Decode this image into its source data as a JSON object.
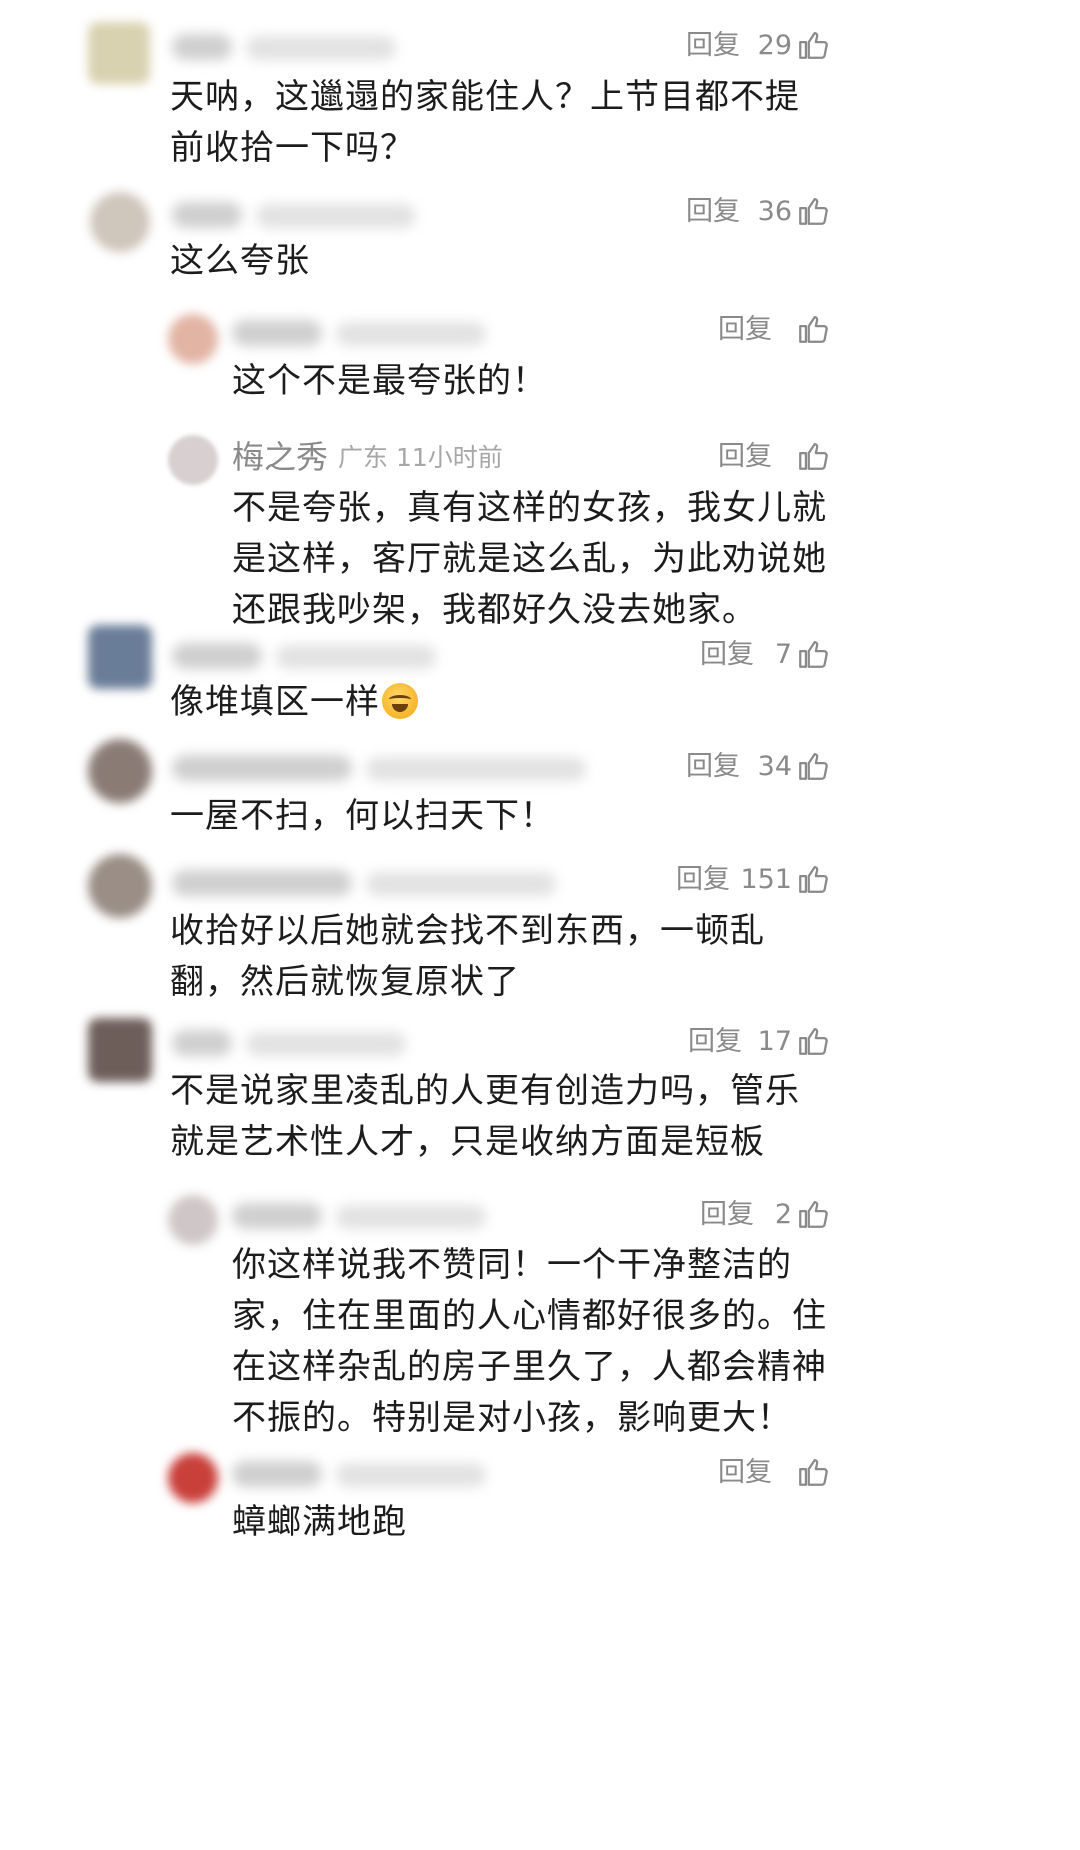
{
  "comments": [
    {
      "reply_label": "回复",
      "likes": "29",
      "text": "天呐，这邋遢的家能住人？上节目都不提前收拾一下吗？"
    },
    {
      "reply_label": "回复",
      "likes": "36",
      "text": "这么夸张"
    },
    {
      "reply_label": "回复",
      "likes": "",
      "text": "这个不是最夸张的！"
    },
    {
      "reply_label": "回复",
      "likes": "",
      "user_name": "梅之秀",
      "meta": "广东 11小时前",
      "text": "不是夸张，真有这样的女孩，我女儿就是这样，客厅就是这么乱，为此劝说她还跟我吵架，我都好久没去她家。"
    },
    {
      "reply_label": "回复",
      "likes": "7",
      "text": "像堆填区一样"
    },
    {
      "reply_label": "回复",
      "likes": "34",
      "text": "一屋不扫，何以扫天下！"
    },
    {
      "reply_label": "回复",
      "likes": "151",
      "text": "收拾好以后她就会找不到东西，一顿乱翻，然后就恢复原状了"
    },
    {
      "reply_label": "回复",
      "likes": "17",
      "text": "不是说家里凌乱的人更有创造力吗，管乐就是艺术性人才，只是收纳方面是短板"
    },
    {
      "reply_label": "回复",
      "likes": "2",
      "text": "你这样说我不赞同！一个干净整洁的家，住在里面的人心情都好很多的。住在这样杂乱的房子里久了，人都会精神不振的。特别是对小孩，影响更大！"
    },
    {
      "reply_label": "回复",
      "likes": "",
      "text": "蟑螂满地跑"
    }
  ],
  "colors": {
    "text": "#1c1c1c",
    "secondary": "#8a8a8a",
    "background": "#ffffff"
  },
  "icons": {
    "like": "thumbs-up-outline-icon",
    "emoji": "laughing-crying-emoji-icon"
  }
}
